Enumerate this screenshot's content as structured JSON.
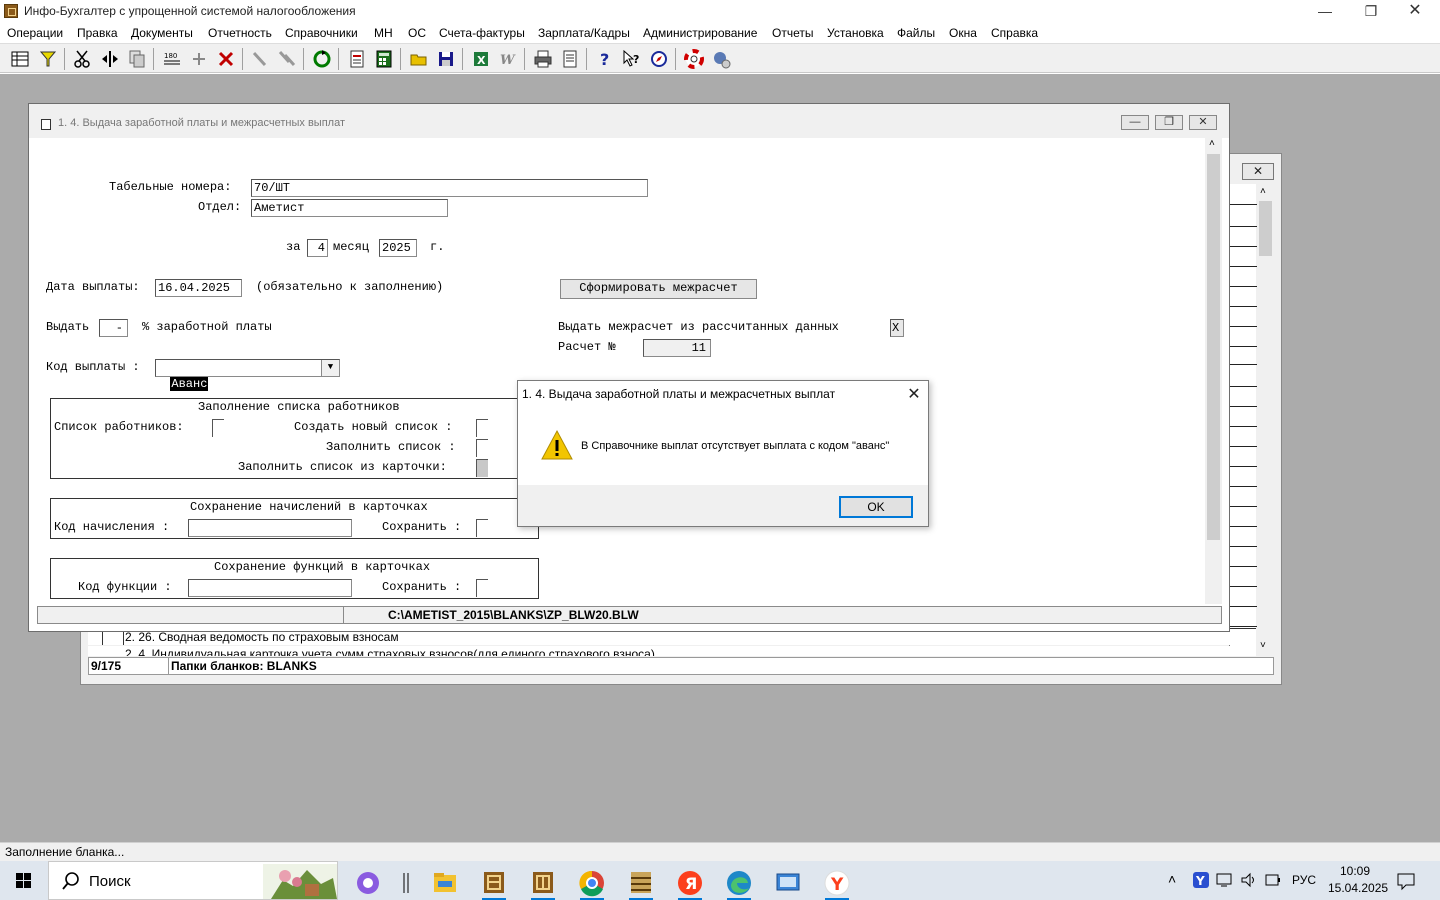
{
  "app": {
    "title": "Инфо-Бухгалтер с упрощенной системой налогообложения",
    "min_icon": "minimize-icon",
    "restore_icon": "restore-icon",
    "close_icon": "close-icon"
  },
  "menu": [
    "Операции",
    "Правка",
    "Документы",
    "Отчетность",
    "Справочники",
    "МН",
    "ОС",
    "Счета-фактуры",
    "Зарплата/Кадры",
    "Администрирование",
    "Отчеты",
    "Установка",
    "Файлы",
    "Окна",
    "Справка"
  ],
  "toolbar_icons": [
    "grid-icon",
    "filter-icon",
    "cut-icon",
    "split-icon",
    "copy-icon",
    "counter-icon",
    "add-icon",
    "delete-icon",
    "pen-icon",
    "pen-multi-icon",
    "refresh-icon",
    "pdf-icon",
    "calculator-icon",
    "open-folder-icon",
    "save-icon",
    "excel-icon",
    "word-icon",
    "print-icon",
    "preview-icon",
    "help-icon",
    "context-help-icon",
    "compass-icon",
    "lifebuoy-icon",
    "globe-icon"
  ],
  "background_window": {
    "list_line1": "2. 26. Сводная ведомость по страховым взносам",
    "list_line2": "2. 4. Индивидуальная карточка учета сумм страховых взносов(для единого страхового взноса)",
    "status_count": "9/175",
    "status_folders": "Папки бланков: BLANKS"
  },
  "form": {
    "title": "1. 4. Выдача заработной платы и межрасчетных выплат",
    "tabel_label": "Табельные номера:",
    "tabel_value": "70/ШТ",
    "otdel_label": "Отдел:",
    "otdel_value": "Аметист",
    "za_label": "за",
    "month_value": "4",
    "month_label": "месяц",
    "year_value": "2025",
    "year_suffix": "г.",
    "date_label": "Дата выплаты:",
    "date_value": "16.04.2025",
    "date_note": "(обязательно к заполнению)",
    "form_button": "Сформировать межрасчет",
    "vydat_label": "Выдать",
    "percent_value": "-",
    "percent_label": "% заработной платы",
    "mezh_label": "Выдать межрасчет из рассчитанных данных",
    "mezh_check": "X",
    "raschet_label": "Расчет №",
    "raschet_value": "11",
    "kod_label": "Код выплаты :",
    "kod_value": "Аванс",
    "group1_title": "Заполнение списка работников",
    "spisok_label": "Список работников:",
    "create_label": "Создать новый список :",
    "fill_label": "Заполнить список :",
    "fill_card_label": "Заполнить список из карточки:",
    "group2_title": "Сохранение начислений в карточках",
    "kod_nach_label": "Код начисления :",
    "save_label": "Сохранить :",
    "group3_title": "Сохранение функций в карточках",
    "kod_func_label": "Код функции :",
    "save_label2": "Сохранить :",
    "status_path": "C:\\AMETIST_2015\\BLANKS\\ZP_BLW20.BLW"
  },
  "dialog": {
    "title": "1. 4. Выдача заработной платы и межрасчетных выплат",
    "message": "В Справочнике выплат отсутствует выплата с кодом \"аванс\"",
    "ok": "OK"
  },
  "status_bar": "Заполнение бланка...",
  "taskbar": {
    "search": "Поиск",
    "lang": "РУС",
    "time": "10:09",
    "date": "15.04.2025"
  }
}
